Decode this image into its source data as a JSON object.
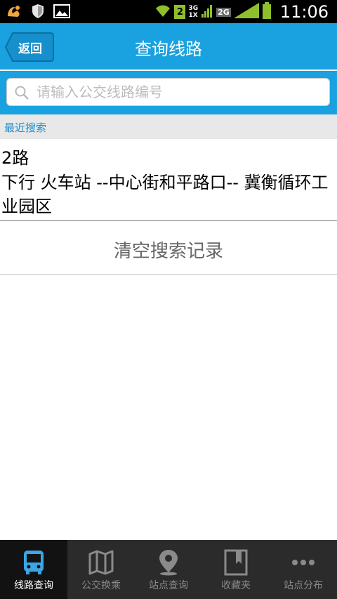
{
  "status_bar": {
    "sim_slot": "2",
    "net1": "3G",
    "net1b": "1X",
    "net2": "2G",
    "time": "11:06"
  },
  "header": {
    "back_label": "返回",
    "title": "查询线路"
  },
  "search": {
    "placeholder": "请输入公交线路编号",
    "value": ""
  },
  "recent": {
    "label": "最近搜索",
    "items": [
      {
        "name": "2路",
        "description": "下行 火车站 --中心街和平路口-- 冀衡循环工业园区"
      }
    ]
  },
  "clear_history_label": "清空搜索记录",
  "bottom_nav": {
    "tabs": [
      {
        "label": "线路查询",
        "icon": "bus-icon",
        "active": true
      },
      {
        "label": "公交换乘",
        "icon": "map-icon",
        "active": false
      },
      {
        "label": "站点查询",
        "icon": "location-pin-icon",
        "active": false
      },
      {
        "label": "收藏夹",
        "icon": "bookmark-icon",
        "active": false
      },
      {
        "label": "站点分布",
        "icon": "more-dots-icon",
        "active": false
      }
    ]
  },
  "colors": {
    "header_blue": "#1aa1df",
    "accent_blue": "#1a8fd0",
    "nav_bg": "#2b2b2b",
    "wifi_green": "#8fbf2a"
  }
}
